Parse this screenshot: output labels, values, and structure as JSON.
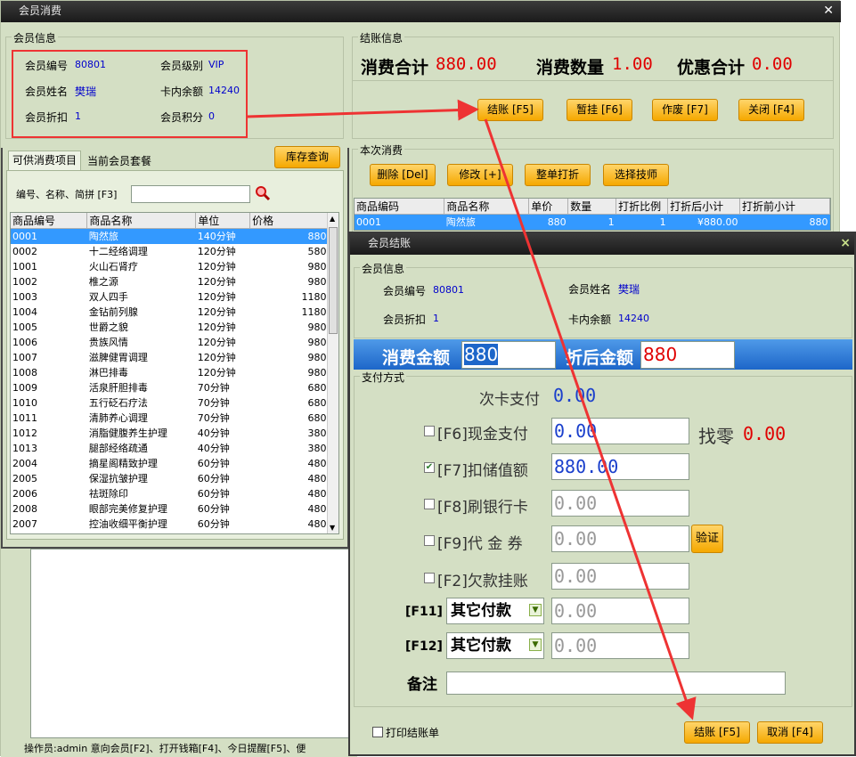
{
  "main_window": {
    "title": "会员消费",
    "close_glyph": "✕",
    "member_info": {
      "legend": "会员信息",
      "id_label": "会员编号",
      "id_value": "80801",
      "level_label": "会员级别",
      "level_value": "VIP",
      "name_label": "会员姓名",
      "name_value": "樊瑞",
      "balance_label": "卡内余额",
      "balance_value": "14240",
      "discount_label": "会员折扣",
      "discount_value": "1",
      "points_label": "会员积分",
      "points_value": "0"
    },
    "checkout_info": {
      "legend": "结账信息",
      "total_label": "消费合计",
      "total_value": "880.00",
      "qty_label": "消费数量",
      "qty_value": "1.00",
      "discount_label": "优惠合计",
      "discount_value": "0.00"
    },
    "buttons": {
      "checkout": "结账 [F5]",
      "hold": "暂挂 [F6]",
      "void": "作废 [F7]",
      "close": "关闭 [F4]",
      "stock": "库存查询"
    },
    "tabs": [
      "可供消费项目",
      "当前会员套餐"
    ],
    "search_label": "编号、名称、简拼 [F3]",
    "product_table": {
      "headers": [
        "商品编号",
        "商品名称",
        "单位",
        "价格"
      ],
      "rows": [
        [
          "0001",
          "陶然旅",
          "140分钟",
          "880"
        ],
        [
          "0002",
          "十二经络调理",
          "120分钟",
          "580"
        ],
        [
          "1001",
          "火山石肾疗",
          "120分钟",
          "980"
        ],
        [
          "1002",
          "椎之源",
          "120分钟",
          "980"
        ],
        [
          "1003",
          "双人四手",
          "120分钟",
          "1180"
        ],
        [
          "1004",
          "金钻前列腺",
          "120分钟",
          "1180"
        ],
        [
          "1005",
          "世爵之貌",
          "120分钟",
          "980"
        ],
        [
          "1006",
          "贵族风情",
          "120分钟",
          "980"
        ],
        [
          "1007",
          "滋脾健胃调理",
          "120分钟",
          "980"
        ],
        [
          "1008",
          "淋巴排毒",
          "120分钟",
          "980"
        ],
        [
          "1009",
          "活泉肝胆排毒",
          "70分钟",
          "680"
        ],
        [
          "1010",
          "五行砭石疗法",
          "70分钟",
          "680"
        ],
        [
          "1011",
          "清肺养心调理",
          "70分钟",
          "680"
        ],
        [
          "1012",
          "消脂健腹养生护理",
          "40分钟",
          "380"
        ],
        [
          "1013",
          "腿部经络疏通",
          "40分钟",
          "380"
        ],
        [
          "2004",
          "摘星阁精致护理",
          "60分钟",
          "480"
        ],
        [
          "2005",
          "保湿抗皱护理",
          "60分钟",
          "480"
        ],
        [
          "2006",
          "祛斑除印",
          "60分钟",
          "480"
        ],
        [
          "2008",
          "眼部完美修复护理",
          "60分钟",
          "480"
        ],
        [
          "2007",
          "控油收细平衡护理",
          "60分钟",
          "480"
        ]
      ]
    },
    "current_consumption": {
      "legend": "本次消费",
      "delete": "删除 [Del]",
      "modify": "修改 [+]",
      "whole_discount": "整单打折",
      "choose_tech": "选择技师",
      "headers": [
        "商品编码",
        "商品名称",
        "单价",
        "数量",
        "打折比例",
        "打折后小计",
        "打折前小计"
      ],
      "rows": [
        [
          "0001",
          "陶然旅",
          "880",
          "1",
          "1",
          "¥880.00",
          "880"
        ]
      ]
    },
    "status_bar": "操作员:admin    意向会员[F2]、打开钱箱[F4]、今日提醒[F5]、便"
  },
  "dialog": {
    "title": "会员结账",
    "close_glyph": "×",
    "member_info": {
      "legend": "会员信息",
      "id_label": "会员编号",
      "id_value": "80801",
      "name_label": "会员姓名",
      "name_value": "樊瑞",
      "discount_label": "会员折扣",
      "discount_value": "1",
      "balance_label": "卡内余额",
      "balance_value": "14240"
    },
    "amount_label": "消费金额",
    "amount_value": "880",
    "after_discount_label": "折后金额",
    "after_discount_value": "880",
    "payment": {
      "legend": "支付方式",
      "card_times_label": "次卡支付",
      "card_times_value": "0.00",
      "cash_label": "[F6]现金支付",
      "cash_value": "0.00",
      "change_label": "找零",
      "change_value": "0.00",
      "stored_label": "[F7]扣储值额",
      "stored_value": "880.00",
      "bank_label": "[F8]刷银行卡",
      "bank_value": "0.00",
      "voucher_label": "[F9]代 金 券",
      "voucher_value": "0.00",
      "verify_button": "验证",
      "credit_label": "[F2]欠款挂账",
      "credit_value": "0.00",
      "f11_label": "[F11]",
      "f11_select": "其它付款",
      "f11_value": "0.00",
      "f12_label": "[F12]",
      "f12_select": "其它付款",
      "f12_value": "0.00",
      "remark_label": "备注",
      "remark_value": ""
    },
    "print_label": "打印结账单",
    "checkout_button": "结账 [F5]",
    "cancel_button": "取消 [F4]"
  },
  "colors": {
    "accent_orange": "#f5a800",
    "panel_green": "#d4dfc4",
    "highlight_red": "#e00000",
    "value_blue": "#0000cc",
    "annotation_red": "#ee3333"
  }
}
